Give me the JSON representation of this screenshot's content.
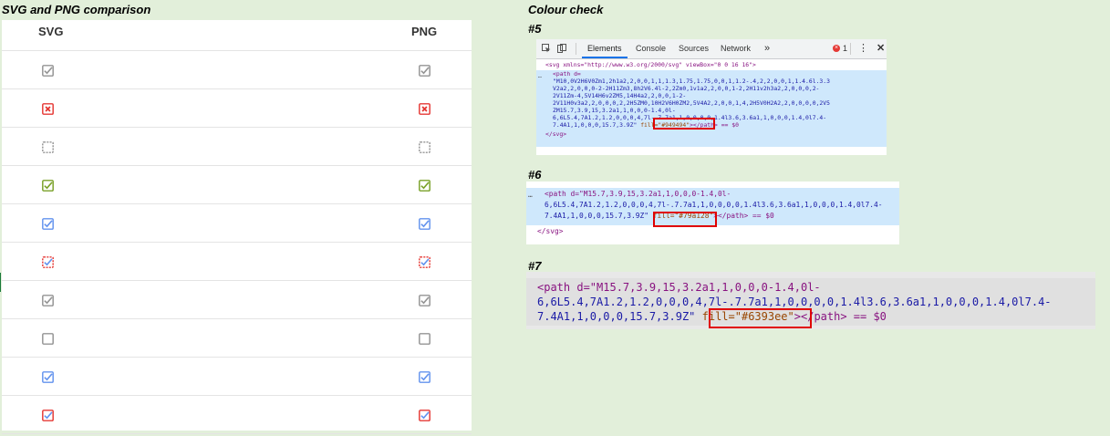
{
  "left_section": {
    "title": "SVG and PNG comparison",
    "headers": {
      "svg": "SVG",
      "png": "PNG"
    },
    "rows": [
      {
        "kind": "checked",
        "color": "#949494"
      },
      {
        "kind": "error",
        "color": "#e53935"
      },
      {
        "kind": "dashed-empty",
        "color": "#949494"
      },
      {
        "kind": "checked",
        "color": "#79a128"
      },
      {
        "kind": "checked",
        "color": "#6393ee"
      },
      {
        "kind": "checked-dashed",
        "color": "#6393ee",
        "border": "#e53935"
      },
      {
        "kind": "checked",
        "color": "#949494"
      },
      {
        "kind": "empty",
        "color": "#949494"
      },
      {
        "kind": "checked",
        "color": "#6393ee"
      },
      {
        "kind": "checked",
        "color": "#6393ee",
        "border": "#e53935"
      }
    ]
  },
  "right_section": {
    "title": "Colour check",
    "snapshots": [
      {
        "label": "#5",
        "tabs": [
          "Elements",
          "Console",
          "Sources",
          "Network"
        ],
        "more": "»",
        "error_count": "1",
        "lines": [
          "<svg xmlns=\"http://www.w3.org/2000/svg\" viewBox=\"0 0 16 16\">",
          "<path d=",
          "\"M10,0V2H6V0Zm1,2h1a2,2,0,0,1,1,1.3,1.75,1.75,0,0,1,1.2-.4,2,2,0,0,1,1.4.6l.3.3",
          "V2a2,2,0,0,0-2-2H11Zm3,8h2V6.4l-2,2Zm0,1v1a2,2,0,0,1-2,2H11v2h3a2,2,0,0,0,2-",
          "2V11Zm-4,5V14H6v2ZM5,14H4a2,2,0,0,1-2-",
          "2V11H0v3a2,2,0,0,0,2,2H5ZM0,10H2V6H0ZM2,5V4A2,2,0,0,1,4,2H5V0H2A2,2,0,0,0,0,2V5",
          "ZM15.7,3.9,15,3.2a1,1,0,0,0-1.4,0l-",
          "6,6L5.4,7A1.2,1.2,0,0,0,4,7l-.7.7a1,1,0,0,0,0,1.4l3.6,3.6a1,1,0,0,0,1.4,0l7.4-",
          "7.4A1,1,0,0,0,15.7,3.9Z\"",
          " fill=\"#949494\"",
          "></path> == $0",
          "</svg>"
        ]
      },
      {
        "label": "#6",
        "lines": [
          "<path d=\"M15.7,3.9,15,3.2a1,1,0,0,0-1.4,0l-",
          "6,6L5.4,7A1.2,1.2,0,0,0,4,7l-.7.7a1,1,0,0,0,0,1.4l3.6,3.6a1,1,0,0,0,1.4,0l7.4-",
          "7.4A1,1,0,0,0,15.7,3.9Z\"",
          " fill=\"#79a128\"",
          "></path> == $0",
          "</svg>"
        ]
      },
      {
        "label": "#7",
        "lines": [
          "<path d=\"M15.7,3.9,15,3.2a1,1,0,0,0-1.4,0l-",
          "6,6L5.4,7A1.2,1.2,0,0,0,4,7l-.7.7a1,1,0,0,0,0,1.4l3.6,3.6a1,1,0,0,0,1.4,0l7.4-",
          "7.4A1,1,0,0,0,15.7,3.9Z\"",
          " fill=\"#6393ee\"",
          "></path> == $0"
        ]
      }
    ]
  }
}
